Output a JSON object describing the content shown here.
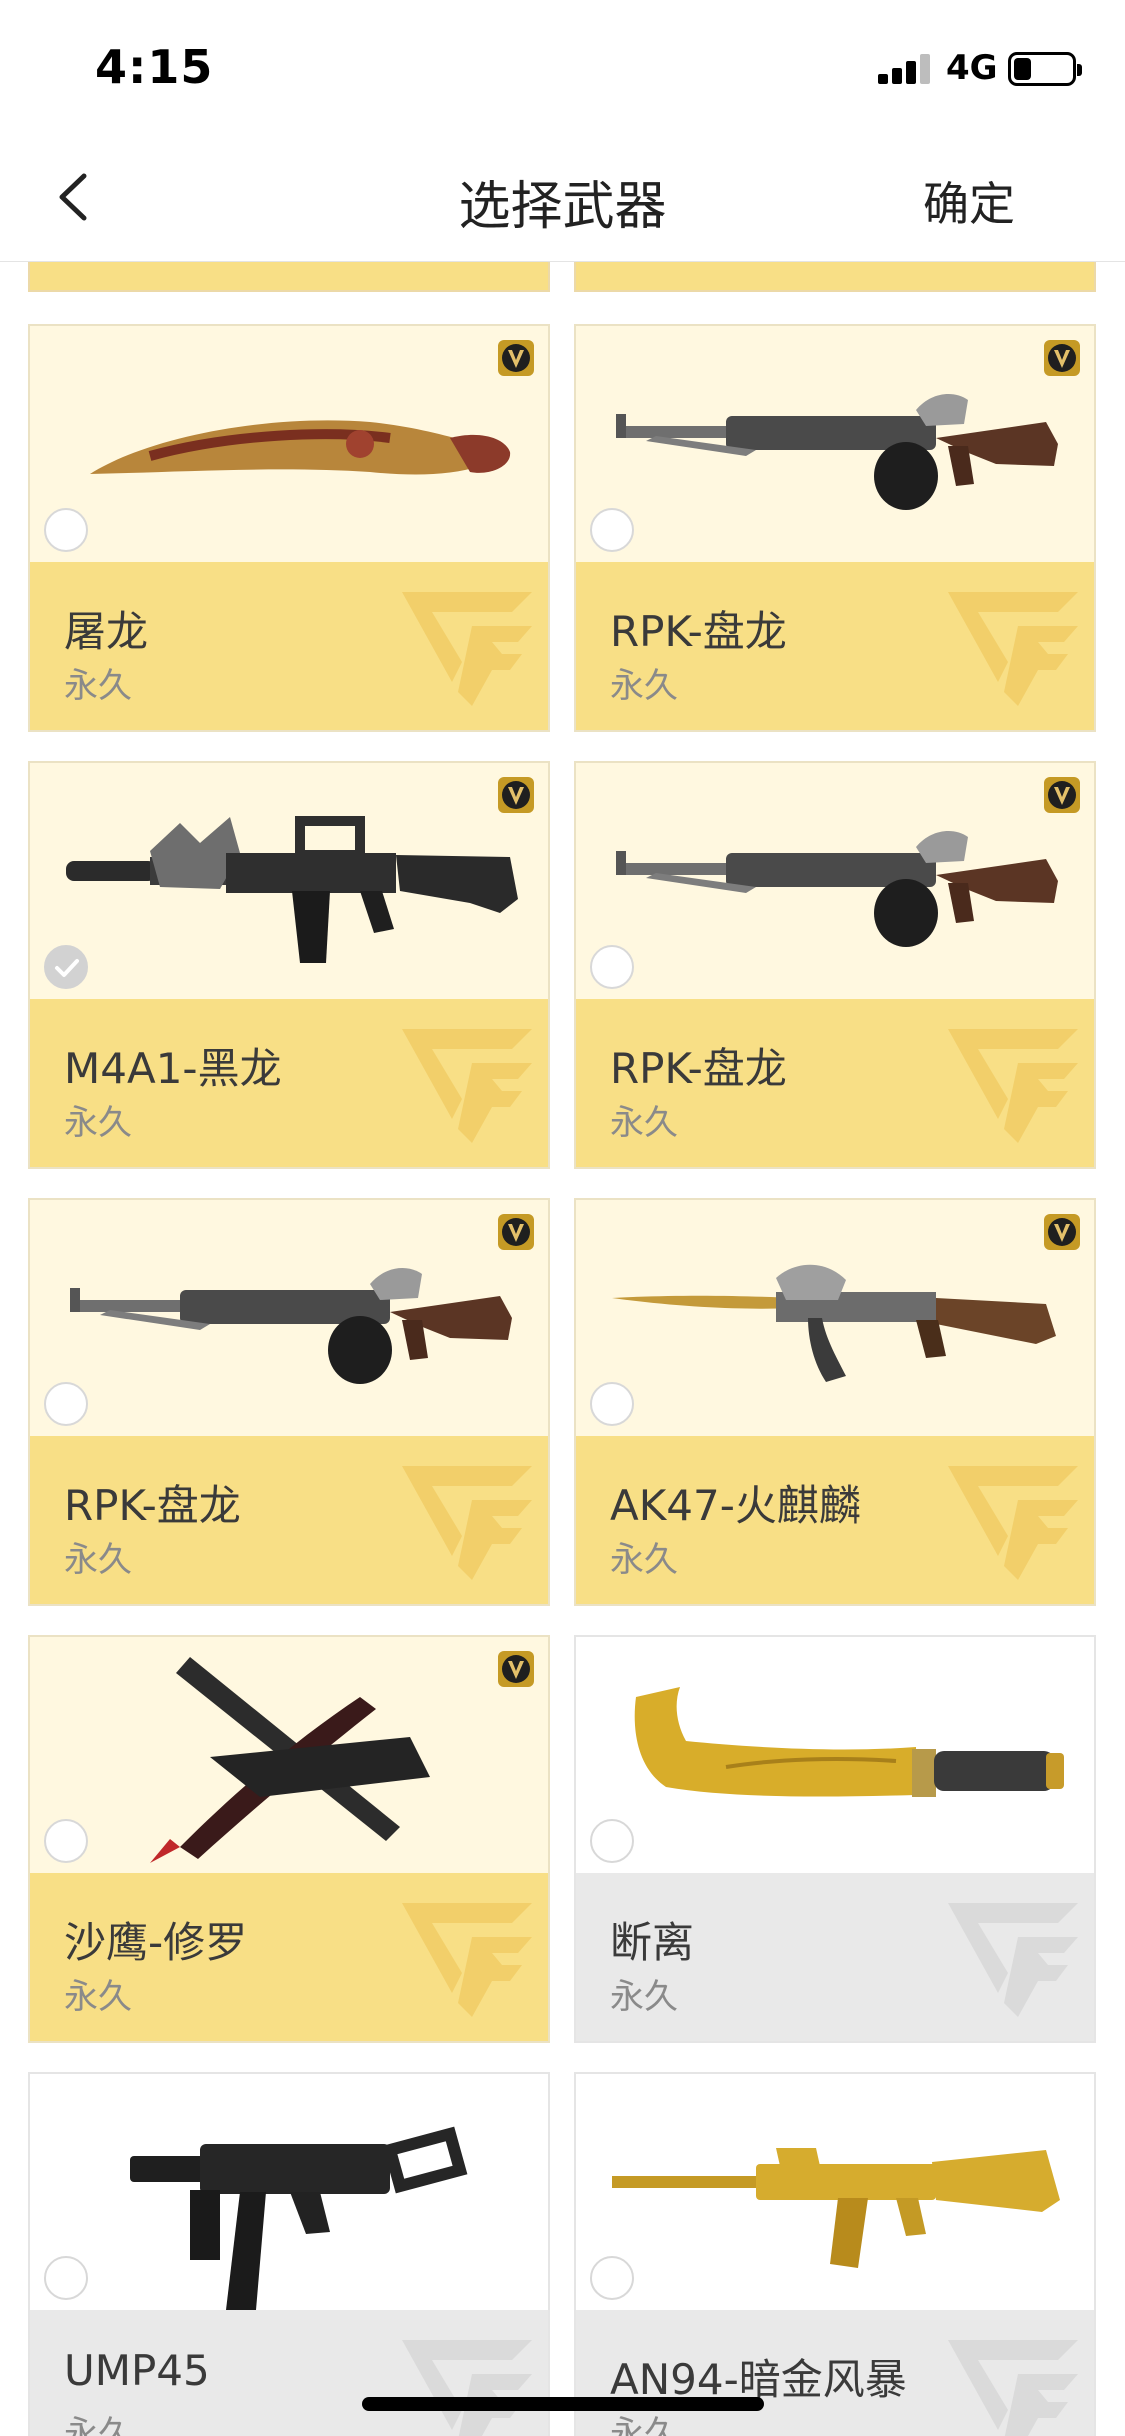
{
  "status_bar": {
    "time": "4:15",
    "network": "4G",
    "battery_level": 0.3
  },
  "nav": {
    "title": "选择武器",
    "confirm_label": "确定",
    "back_icon": "chevron-left-icon"
  },
  "colors": {
    "gold_card_bg": "#fff8e0",
    "gold_footer_bg": "#f8df86",
    "grey_footer_bg": "#e9e9e9",
    "watermark_gold": "#f2cf6a",
    "watermark_grey": "#dadada"
  },
  "weapons": [
    {
      "name": "屠龙",
      "duration": "永久",
      "theme": "gold",
      "vip": true,
      "selected": false,
      "icon": "kukri-knife-icon"
    },
    {
      "name": "RPK-盘龙",
      "duration": "永久",
      "theme": "gold",
      "vip": true,
      "selected": false,
      "icon": "machine-gun-icon"
    },
    {
      "name": "M4A1-黑龙",
      "duration": "永久",
      "theme": "gold",
      "vip": true,
      "selected": true,
      "icon": "assault-rifle-icon"
    },
    {
      "name": "RPK-盘龙",
      "duration": "永久",
      "theme": "gold",
      "vip": true,
      "selected": false,
      "icon": "machine-gun-icon"
    },
    {
      "name": "RPK-盘龙",
      "duration": "永久",
      "theme": "gold",
      "vip": true,
      "selected": false,
      "icon": "machine-gun-icon"
    },
    {
      "name": "AK47-火麒麟",
      "duration": "永久",
      "theme": "gold",
      "vip": true,
      "selected": false,
      "icon": "ak47-icon"
    },
    {
      "name": "沙鹰-修罗",
      "duration": "永久",
      "theme": "gold",
      "vip": true,
      "selected": false,
      "icon": "pistol-icon"
    },
    {
      "name": "断离",
      "duration": "永久",
      "theme": "grey",
      "vip": false,
      "selected": false,
      "icon": "machete-icon"
    },
    {
      "name": "UMP45",
      "duration": "永久",
      "theme": "grey",
      "vip": false,
      "selected": false,
      "icon": "smg-icon"
    },
    {
      "name": "AN94-暗金风暴",
      "duration": "永久",
      "theme": "grey",
      "vip": false,
      "selected": false,
      "icon": "gold-rifle-icon"
    }
  ]
}
